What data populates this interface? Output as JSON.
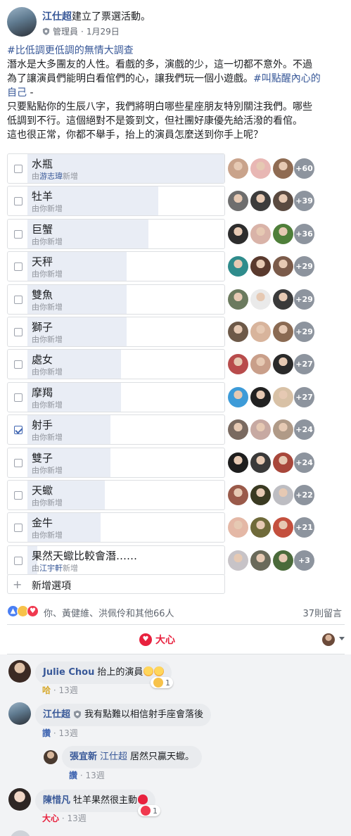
{
  "post": {
    "author": "江仕超",
    "action": "建立了票選活動。",
    "role": "管理員",
    "date": "1月29日",
    "separator": "·",
    "body": {
      "hashtag1": "#比低調更低調的無情大調查",
      "line1": "潛水是大多團友的人性。看戲的多，演戲的少，這一切都不意外。不過",
      "line2_text": "為了讓演員們能明白看倌們的心，讓我們玩一個小遊戲。",
      "hashtag2_part1": "#叫點醒內心的",
      "hashtag2_part2": "自己",
      "line3_suffix": " -",
      "line4": "只要點點你的生辰八字，我們將明白哪些星座朋友特別關注我們。哪些",
      "line5": "低調到不行。這個絕對不是簽到文，但社團好康優先給活潑的看倌。",
      "line6": "這也很正常，你都不舉手，抬上的演員怎麼送到你手上呢？"
    }
  },
  "poll": {
    "options": [
      {
        "label": "水瓶",
        "by_prefix": "由",
        "by_user": "游志瑋",
        "by_suffix": "新增",
        "more": "+60",
        "fill": 1.0,
        "checked": false
      },
      {
        "label": "牡羊",
        "by_prefix": "由你新增",
        "by_user": "",
        "by_suffix": "",
        "more": "+39",
        "fill": 0.66,
        "checked": false
      },
      {
        "label": "巨蟹",
        "by_prefix": "由你新增",
        "by_user": "",
        "by_suffix": "",
        "more": "+36",
        "fill": 0.61,
        "checked": false
      },
      {
        "label": "天秤",
        "by_prefix": "由你新增",
        "by_user": "",
        "by_suffix": "",
        "more": "+29",
        "fill": 0.5,
        "checked": false
      },
      {
        "label": "雙魚",
        "by_prefix": "由你新增",
        "by_user": "",
        "by_suffix": "",
        "more": "+29",
        "fill": 0.5,
        "checked": false
      },
      {
        "label": "獅子",
        "by_prefix": "由你新增",
        "by_user": "",
        "by_suffix": "",
        "more": "+29",
        "fill": 0.5,
        "checked": false
      },
      {
        "label": "處女",
        "by_prefix": "由你新增",
        "by_user": "",
        "by_suffix": "",
        "more": "+27",
        "fill": 0.47,
        "checked": false
      },
      {
        "label": "摩羯",
        "by_prefix": "由你新增",
        "by_user": "",
        "by_suffix": "",
        "more": "+27",
        "fill": 0.47,
        "checked": false
      },
      {
        "label": "射手",
        "by_prefix": "由你新增",
        "by_user": "",
        "by_suffix": "",
        "more": "+24",
        "fill": 0.42,
        "checked": true
      },
      {
        "label": "雙子",
        "by_prefix": "由你新增",
        "by_user": "",
        "by_suffix": "",
        "more": "+24",
        "fill": 0.42,
        "checked": false
      },
      {
        "label": "天蠍",
        "by_prefix": "由你新增",
        "by_user": "",
        "by_suffix": "",
        "more": "+22",
        "fill": 0.39,
        "checked": false
      },
      {
        "label": "金牛",
        "by_prefix": "由你新增",
        "by_user": "",
        "by_suffix": "",
        "more": "+21",
        "fill": 0.37,
        "checked": false
      },
      {
        "label": "果然天蠍比較會潛……",
        "by_prefix": "由",
        "by_user": "江宇軒",
        "by_suffix": "新增",
        "more": "+3",
        "fill": 0.05,
        "checked": false
      }
    ],
    "add_option_label": "新增選項",
    "add_option_icon": "+"
  },
  "reactions": {
    "summary": "你、黃健維、洪佩伶和其他66人",
    "comment_count": "37則留言",
    "like_icon": "👍",
    "haha_icon": "😆",
    "love_icon": "❤"
  },
  "actions": {
    "love_label": "大心",
    "love_icon": "♥"
  },
  "comments": [
    {
      "name": "Julie Chou",
      "text": "抬上的演員",
      "action": "哈",
      "time": "13週",
      "dot": "·",
      "react_count": "1"
    },
    {
      "name": "江仕超",
      "text": "我有點難以相信射手座會落後",
      "action": "讚",
      "time": "13週",
      "dot": "·"
    },
    {
      "name": "張宜新",
      "mention": "江仕超",
      "text": "居然只贏天蠍。",
      "action": "讚",
      "time": "13週",
      "dot": "·"
    },
    {
      "name": "陳惜凡",
      "text": "牡羊果然很主動",
      "action": "大心",
      "time": "13週",
      "dot": "·",
      "react_count": "1"
    }
  ],
  "colors": {
    "link": "#385898",
    "poll_fill": "#e9edf5",
    "love": "#e8213e",
    "check": "#4267b2"
  }
}
